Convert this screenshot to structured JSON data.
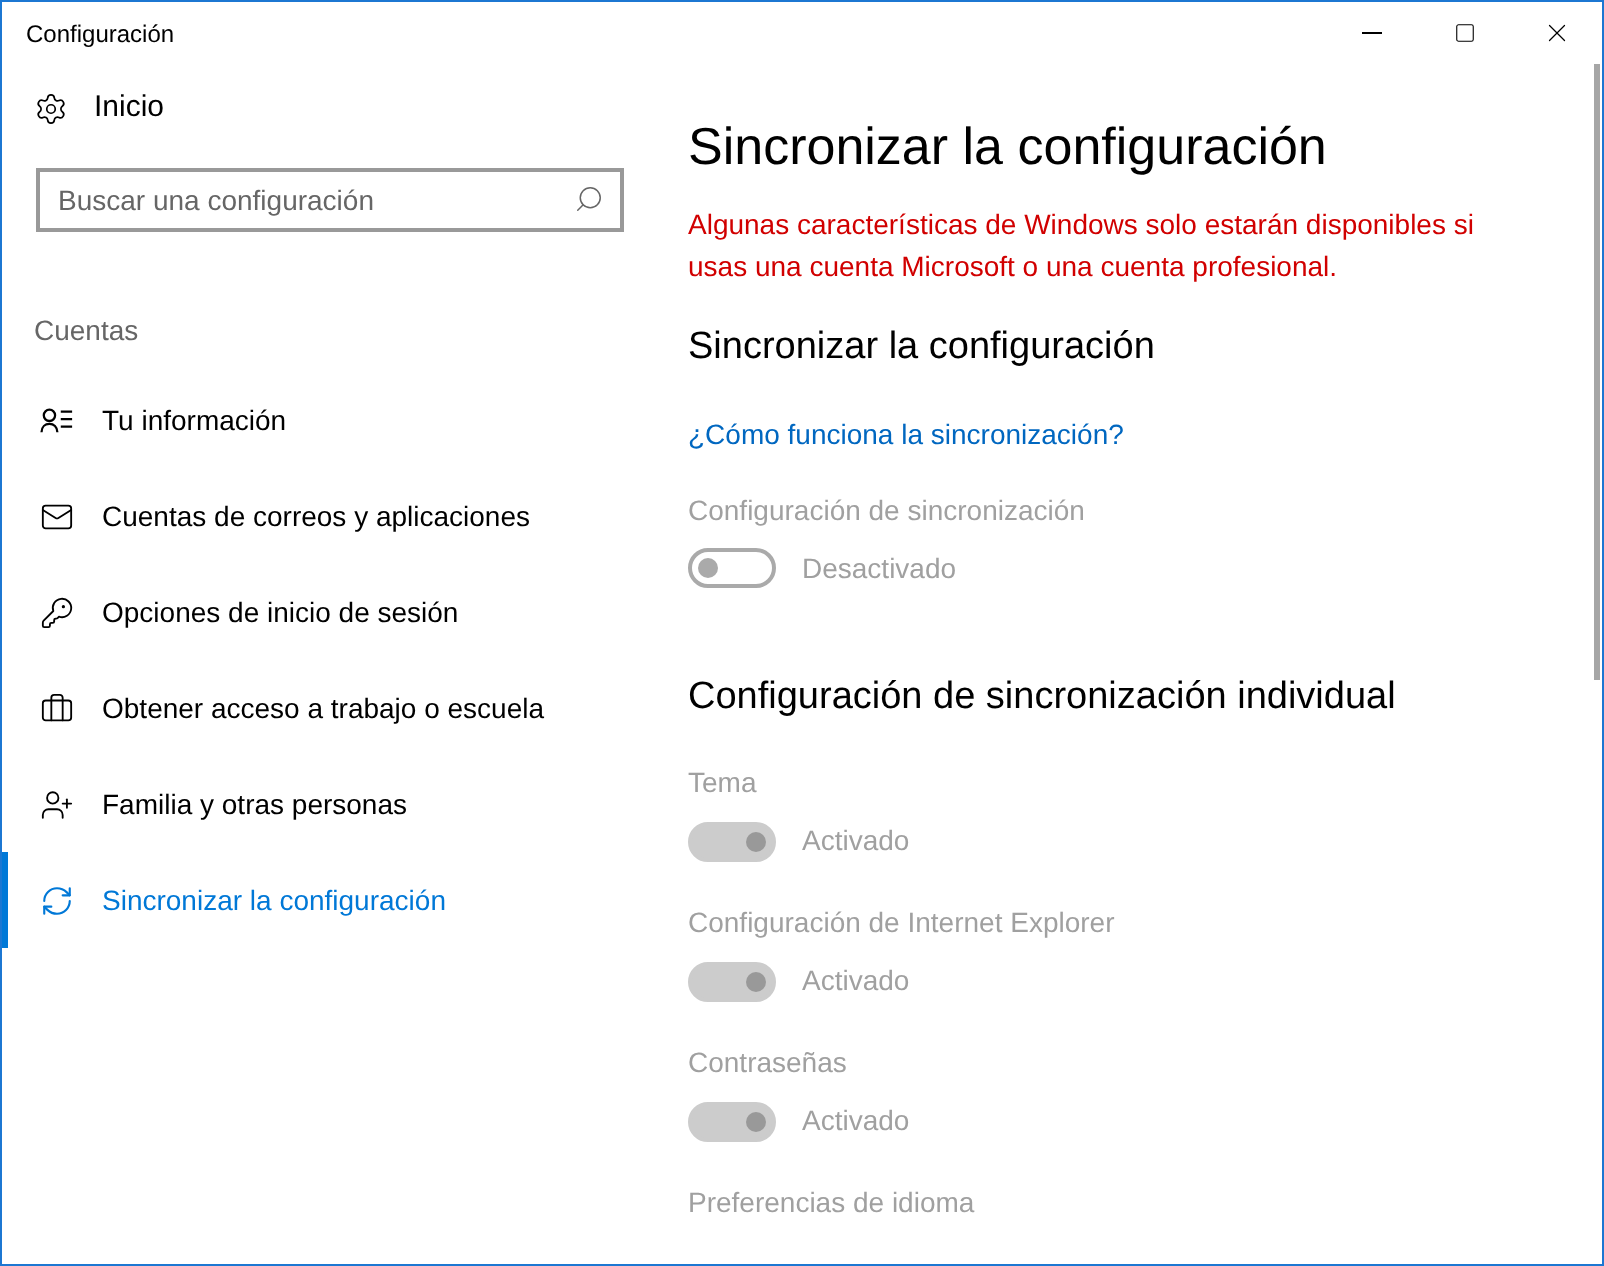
{
  "window": {
    "title": "Configuración"
  },
  "sidebar": {
    "home": "Inicio",
    "search": {
      "placeholder": "Buscar una configuración"
    },
    "section": "Cuentas",
    "items": [
      {
        "label": "Tu información",
        "selected": false
      },
      {
        "label": "Cuentas de correos y aplicaciones",
        "selected": false
      },
      {
        "label": "Opciones de inicio de sesión",
        "selected": false
      },
      {
        "label": "Obtener acceso a trabajo o escuela",
        "selected": false
      },
      {
        "label": "Familia y otras personas",
        "selected": false
      },
      {
        "label": "Sincronizar la configuración",
        "selected": true
      }
    ]
  },
  "content": {
    "title": "Sincronizar la configuración",
    "warning": "Algunas características de Windows solo estarán disponibles si usas una cuenta Microsoft o una cuenta profesional.",
    "section": "Sincronizar la configuración",
    "link": "¿Cómo funciona la sincronización?",
    "main_setting": {
      "label": "Configuración de sincronización",
      "on": false,
      "disabled": true,
      "state": "Desactivado"
    },
    "individual_title": "Configuración de sincronización individual",
    "settings": [
      {
        "kind": "toggle",
        "label": "Tema",
        "on": true,
        "disabled": true,
        "state": "Activado"
      },
      {
        "kind": "toggle",
        "label": "Configuración de Internet Explorer",
        "on": true,
        "disabled": true,
        "state": "Activado"
      },
      {
        "kind": "toggle",
        "label": "Contraseñas",
        "on": true,
        "disabled": true,
        "state": "Activado"
      },
      {
        "kind": "label",
        "label": "Preferencias de idioma",
        "disabled": true
      }
    ]
  }
}
